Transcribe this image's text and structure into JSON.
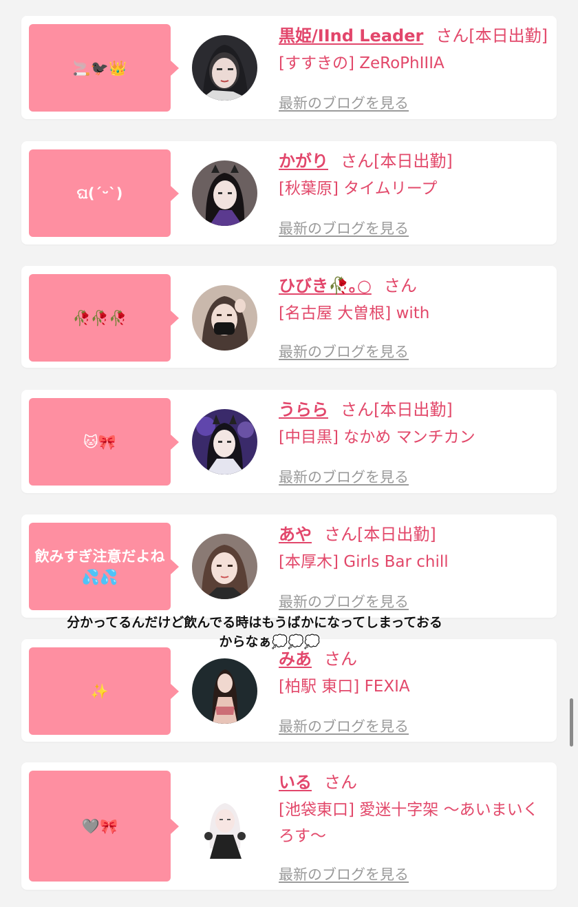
{
  "caption": {
    "line1": "分かってるんだけど飲んでる時はもうばかになってしまっておる",
    "line2": "からなぁ💭💭💭"
  },
  "blog_link_label": "最新のブログを見る",
  "entries": [
    {
      "bubble": "🚬🐦‍⬛👑",
      "name": "黒姫/IInd Leader",
      "suffix": "さん[本日出勤]",
      "shop": "[すすきの] ZeRoPhIIIA"
    },
    {
      "bubble": "ଘ(ˊᵕˋ)",
      "name": "かがり",
      "suffix": "さん[本日出勤]",
      "shop": "[秋葉原] タイムリープ"
    },
    {
      "bubble": "🥀🥀🥀",
      "name": "ひびき🥀｡○",
      "suffix": "さん",
      "shop": "[名古屋 大曽根] with"
    },
    {
      "bubble": "🐱🎀",
      "name": "うらら",
      "suffix": "さん[本日出勤]",
      "shop": "[中目黒] なかめ マンチカン"
    },
    {
      "bubble": "飲みすぎ注意だよね💦💦",
      "name": "あや",
      "suffix": "さん[本日出勤]",
      "shop": "[本厚木] Girls Bar chill"
    },
    {
      "bubble": "✨",
      "name": "みあ",
      "suffix": "さん",
      "shop": "[柏駅 東口] FEXIA"
    },
    {
      "bubble": "🩶🎀",
      "name": "いる",
      "suffix": "さん",
      "shop": "[池袋東口] 愛迷十字架 〜あいまいくろす〜"
    }
  ],
  "colors": {
    "background": "#f3f3f3",
    "bubble": "#fe8fa1",
    "name": "#e2466b",
    "link": "#9a9a9a"
  }
}
